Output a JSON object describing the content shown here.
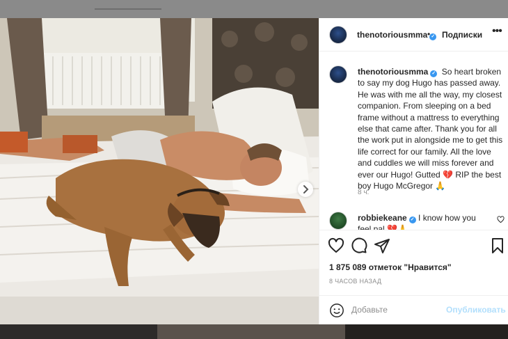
{
  "post": {
    "author": "thenotoriousmma",
    "follow_label": "Подписки",
    "dot": "•",
    "more_label": "•••",
    "caption": "So heart broken to say my dog Hugo has passed away. He was with me all the way, my closest companion. From sleeping on a bed frame without a mattress to everything else that came after. Thank you for all the work put in alongside me to get this life correct for our family. All the love and cuddles we will miss forever and ever our Hugo! Gutted 💔 RIP the best boy Hugo McGregor 🙏",
    "time_ago": "8 ч.",
    "comment": {
      "author": "robbiekeane",
      "text": "I know how you feel pal 💔🙏"
    },
    "likes": "1 875 089 отметок \"Нравится\"",
    "posted_ago": "8 ЧАСОВ НАЗАД",
    "add_comment_placeholder": "Добавьте",
    "publish_label": "Опубликовать",
    "verified_mark": "✓"
  },
  "icons": {
    "like": "heart-icon",
    "comment": "comment-icon",
    "share": "share-icon",
    "save": "bookmark-icon",
    "emoji": "emoji-icon",
    "next": "chevron-right-icon"
  },
  "carousel": {
    "total": 10,
    "current": 1
  },
  "colors": {
    "accent": "#3897f0",
    "publish_disabled": "#b2dffc",
    "text": "#262626",
    "muted": "#8e8e8e"
  }
}
